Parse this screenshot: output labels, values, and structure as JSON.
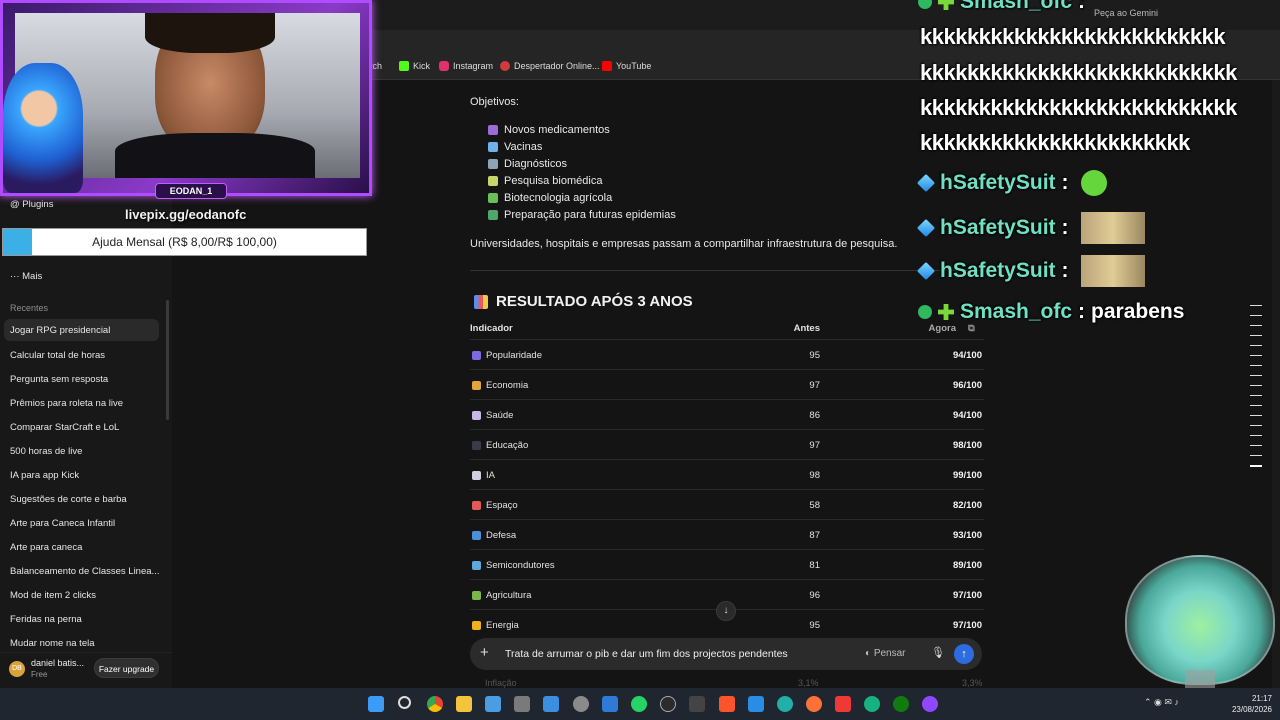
{
  "browser": {
    "gemini_label": "Peça ao Gemini",
    "bookmarks": [
      {
        "label": "itch",
        "color": "#9146ff"
      },
      {
        "label": "Kick",
        "color": "#53fc18"
      },
      {
        "label": "Instagram",
        "color": "#e1306c"
      },
      {
        "label": "Despertador Online...",
        "color": "#d13b3b"
      },
      {
        "label": "YouTube",
        "color": "#ff0000"
      }
    ]
  },
  "sidebar": {
    "plugins": "Plugins",
    "mais": "Mais",
    "recentes_heading": "Recentes",
    "items": [
      "Jogar RPG presidencial",
      "Calcular total de horas",
      "Pergunta sem resposta",
      "Prêmios para roleta na live",
      "Comparar StarCraft e LoL",
      "500 horas de live",
      "IA para app Kick",
      "Sugestões de corte e barba",
      "Arte para Caneca Infantil",
      "Arte para caneca",
      "Balanceamento de Classes Linea...",
      "Mod de item 2 clicks",
      "Feridas na perna",
      "Mudar nome na tela"
    ],
    "user": {
      "initials": "DB",
      "name": "daniel batis...",
      "plan": "Free",
      "upgrade": "Fazer upgrade"
    }
  },
  "main": {
    "objetivos_title": "Objetivos:",
    "objetivos": [
      {
        "label": "Novos medicamentos",
        "color": "#9b6bd6"
      },
      {
        "label": "Vacinas",
        "color": "#6fb1e8"
      },
      {
        "label": "Diagnósticos",
        "color": "#8fa3b8"
      },
      {
        "label": "Pesquisa biomédica",
        "color": "#c7d66b"
      },
      {
        "label": "Biotecnologia agrícola",
        "color": "#6bbf59"
      },
      {
        "label": "Preparação para futuras epidemias",
        "color": "#4fa66a"
      }
    ],
    "paragraph": "Universidades, hospitais e empresas passam a compartilhar infraestrutura de pesquisa.",
    "section_title": "RESULTADO APÓS 3 ANOS",
    "table": {
      "headers": {
        "indicator": "Indicador",
        "before": "Antes",
        "now": "Agora"
      },
      "rows": [
        {
          "indicator": "Popularidade",
          "before": "95",
          "now": "94/100",
          "color": "#7b6be0"
        },
        {
          "indicator": "Economia",
          "before": "97",
          "now": "96/100",
          "color": "#e0a63b"
        },
        {
          "indicator": "Saúde",
          "before": "86",
          "now": "94/100",
          "color": "#c8b8e8"
        },
        {
          "indicator": "Educação",
          "before": "97",
          "now": "98/100",
          "color": "#3a3a4a"
        },
        {
          "indicator": "IA",
          "before": "98",
          "now": "99/100",
          "color": "#d0d0e0"
        },
        {
          "indicator": "Espaço",
          "before": "58",
          "now": "82/100",
          "color": "#e05a5a"
        },
        {
          "indicator": "Defesa",
          "before": "87",
          "now": "93/100",
          "color": "#4a90d9"
        },
        {
          "indicator": "Semicondutores",
          "before": "81",
          "now": "89/100",
          "color": "#5fa8d8"
        },
        {
          "indicator": "Agricultura",
          "before": "96",
          "now": "97/100",
          "color": "#7ab84a"
        },
        {
          "indicator": "Energia",
          "before": "95",
          "now": "97/100",
          "color": "#f0b020"
        }
      ],
      "faded_row": {
        "indicator": "Inflação",
        "before": "3,1%",
        "now": "3,3%"
      }
    },
    "composer": {
      "plus": "+",
      "prompt": "Trata de arrumar o pib e dar um fim dos projectos pendentes",
      "think": "Pensar",
      "mic": "🎙",
      "send": "↑"
    },
    "scroll_down": "↓"
  },
  "stream": {
    "cam_name": "EODAN_1",
    "livepix": "livepix.gg/eodanofc",
    "goal_text": "Ajuda Mensal (R$ 8,00/R$ 100,00)",
    "goal_progress": 0.08
  },
  "chat": {
    "top_user": "Smash_ofc",
    "k_lines": [
      "kkkkkkkkkkkkkkkkkkkkkkkkkk",
      "kkkkkkkkkkkkkkkkkkkkkkkkkkk",
      "kkkkkkkkkkkkkkkkkkkkkkkkkkk",
      "kkkkkkkkkkkkkkkkkkkkkkk"
    ],
    "messages": [
      {
        "user": "hSafetySuit",
        "sep": ":"
      },
      {
        "user": "hSafetySuit",
        "sep": ":"
      },
      {
        "user": "hSafetySuit",
        "sep": ":"
      },
      {
        "user": "Smash_ofc",
        "sep": ":",
        "text": "parabens"
      }
    ]
  },
  "taskbar": {
    "time": "21:17",
    "date": "23/08/2026",
    "icons": [
      "windows-icon",
      "search-icon",
      "chrome-icon",
      "folder-icon",
      "photos-icon",
      "calculator-icon",
      "monitor-icon",
      "settings-icon",
      "store-icon",
      "whatsapp-icon",
      "obs-icon",
      "terminal-icon",
      "brave-icon",
      "vscode-icon",
      "edge-icon",
      "firefox-icon",
      "vivaldi-icon",
      "edge-dev-icon",
      "xbox-icon",
      "twitch-icon"
    ]
  }
}
